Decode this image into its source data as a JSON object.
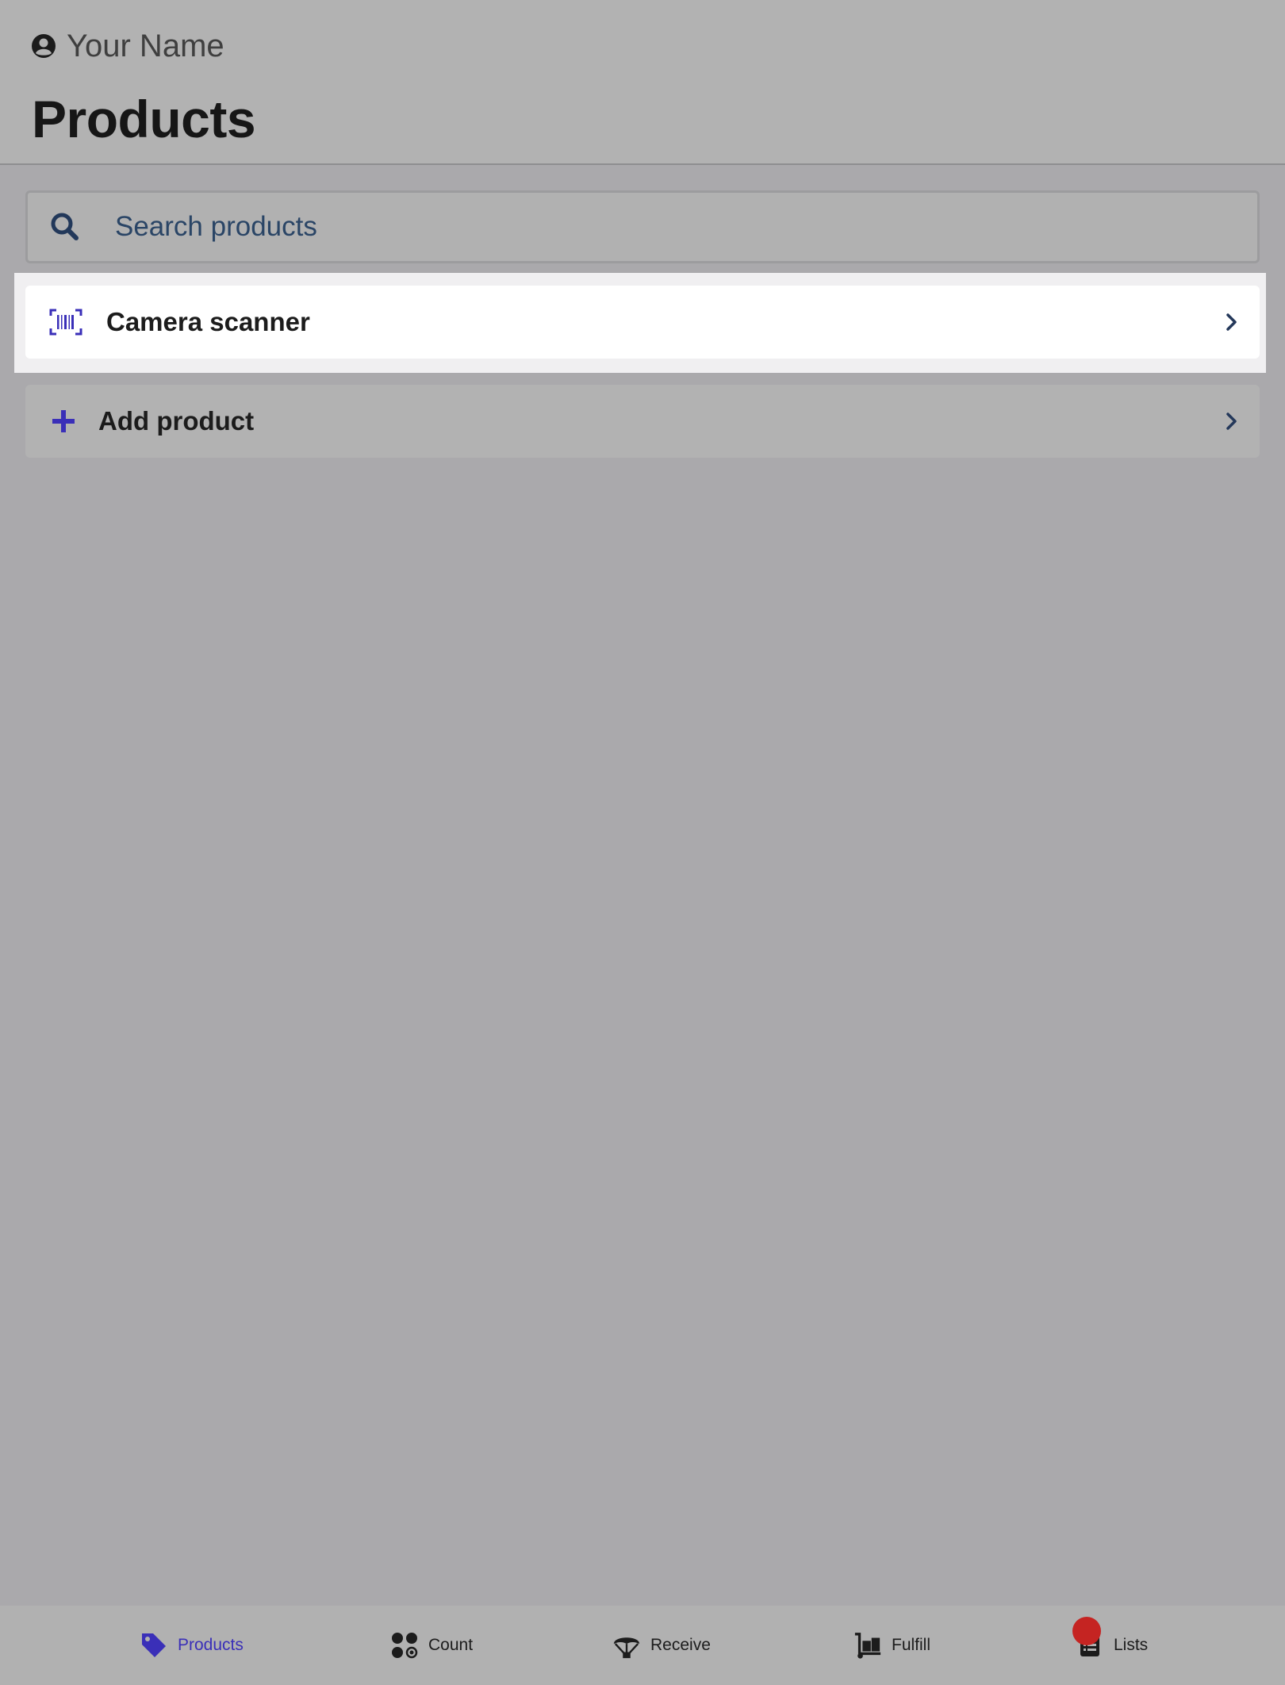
{
  "header": {
    "user_name": "Your Name",
    "title": "Products"
  },
  "search": {
    "placeholder": "Search products",
    "value": ""
  },
  "list": {
    "camera_label": "Camera scanner",
    "add_label": "Add product"
  },
  "nav": {
    "items": [
      {
        "label": "Products",
        "icon": "tag-icon",
        "active": true
      },
      {
        "label": "Count",
        "icon": "count-icon",
        "active": false
      },
      {
        "label": "Receive",
        "icon": "parachute-icon",
        "active": false
      },
      {
        "label": "Fulfill",
        "icon": "dolly-icon",
        "active": false
      },
      {
        "label": "Lists",
        "icon": "list-icon",
        "active": false
      }
    ]
  },
  "colors": {
    "accent": "#3a2fb8",
    "badge": "#c52422",
    "search_text": "#1f3a5c"
  }
}
